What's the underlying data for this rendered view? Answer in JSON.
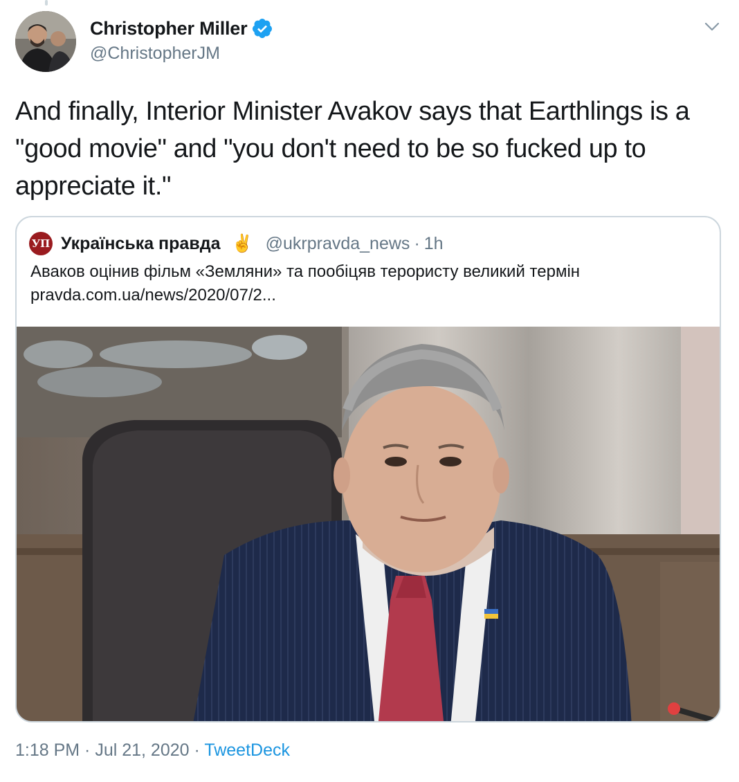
{
  "tweet": {
    "author": {
      "name": "Christopher Miller",
      "handle": "@ChristopherJM",
      "verified": true
    },
    "text": "And finally, Interior Minister Avakov says that Earthlings is a \"good movie\" and \"you don't need to be so fucked up to appreciate it.\"",
    "quoted": {
      "name": "Українська правда",
      "emoji": "✌️",
      "handle": "@ukrpravda_news",
      "separator": "·",
      "time": "1h",
      "text": "Аваков оцінив фільм «Земляни» та пообіцяв терористу великий термін",
      "link": "pravda.com.ua/news/2020/07/2...",
      "logo_text": "УП"
    },
    "footer": {
      "time": "1:18 PM",
      "sep1": " · ",
      "date": "Jul 21, 2020",
      "sep2": " · ",
      "source": "TweetDeck"
    }
  },
  "colors": {
    "verified": "#1da1f2",
    "link": "#1b95e0",
    "secondary_text": "#657786",
    "border": "#ccd6dd"
  },
  "icons": [
    "verified-icon",
    "chevron-down-icon"
  ]
}
